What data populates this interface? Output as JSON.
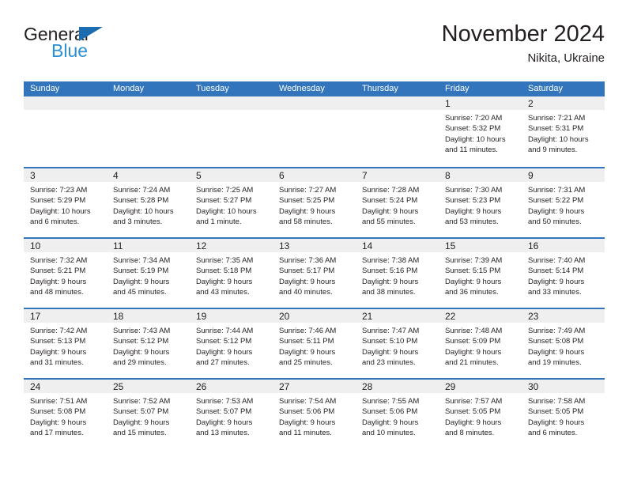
{
  "brand": {
    "line1": "General",
    "line2": "Blue",
    "accent_dark": "#1b6cb0",
    "accent_light": "#2d8fd5"
  },
  "header": {
    "title": "November 2024",
    "subtitle": "Nikita, Ukraine"
  },
  "theme": {
    "header_blue": "#3275bc",
    "day_band_gray": "#efefef",
    "text": "#231f20"
  },
  "weekdays": [
    "Sunday",
    "Monday",
    "Tuesday",
    "Wednesday",
    "Thursday",
    "Friday",
    "Saturday"
  ],
  "weeks": [
    [
      {
        "day": "",
        "empty": true,
        "lines": []
      },
      {
        "day": "",
        "empty": true,
        "lines": []
      },
      {
        "day": "",
        "empty": true,
        "lines": []
      },
      {
        "day": "",
        "empty": true,
        "lines": []
      },
      {
        "day": "",
        "empty": true,
        "lines": []
      },
      {
        "day": "1",
        "empty": false,
        "lines": [
          "Sunrise: 7:20 AM",
          "Sunset: 5:32 PM",
          "Daylight: 10 hours",
          "and 11 minutes."
        ]
      },
      {
        "day": "2",
        "empty": false,
        "lines": [
          "Sunrise: 7:21 AM",
          "Sunset: 5:31 PM",
          "Daylight: 10 hours",
          "and 9 minutes."
        ]
      }
    ],
    [
      {
        "day": "3",
        "empty": false,
        "lines": [
          "Sunrise: 7:23 AM",
          "Sunset: 5:29 PM",
          "Daylight: 10 hours",
          "and 6 minutes."
        ]
      },
      {
        "day": "4",
        "empty": false,
        "lines": [
          "Sunrise: 7:24 AM",
          "Sunset: 5:28 PM",
          "Daylight: 10 hours",
          "and 3 minutes."
        ]
      },
      {
        "day": "5",
        "empty": false,
        "lines": [
          "Sunrise: 7:25 AM",
          "Sunset: 5:27 PM",
          "Daylight: 10 hours",
          "and 1 minute."
        ]
      },
      {
        "day": "6",
        "empty": false,
        "lines": [
          "Sunrise: 7:27 AM",
          "Sunset: 5:25 PM",
          "Daylight: 9 hours",
          "and 58 minutes."
        ]
      },
      {
        "day": "7",
        "empty": false,
        "lines": [
          "Sunrise: 7:28 AM",
          "Sunset: 5:24 PM",
          "Daylight: 9 hours",
          "and 55 minutes."
        ]
      },
      {
        "day": "8",
        "empty": false,
        "lines": [
          "Sunrise: 7:30 AM",
          "Sunset: 5:23 PM",
          "Daylight: 9 hours",
          "and 53 minutes."
        ]
      },
      {
        "day": "9",
        "empty": false,
        "lines": [
          "Sunrise: 7:31 AM",
          "Sunset: 5:22 PM",
          "Daylight: 9 hours",
          "and 50 minutes."
        ]
      }
    ],
    [
      {
        "day": "10",
        "empty": false,
        "lines": [
          "Sunrise: 7:32 AM",
          "Sunset: 5:21 PM",
          "Daylight: 9 hours",
          "and 48 minutes."
        ]
      },
      {
        "day": "11",
        "empty": false,
        "lines": [
          "Sunrise: 7:34 AM",
          "Sunset: 5:19 PM",
          "Daylight: 9 hours",
          "and 45 minutes."
        ]
      },
      {
        "day": "12",
        "empty": false,
        "lines": [
          "Sunrise: 7:35 AM",
          "Sunset: 5:18 PM",
          "Daylight: 9 hours",
          "and 43 minutes."
        ]
      },
      {
        "day": "13",
        "empty": false,
        "lines": [
          "Sunrise: 7:36 AM",
          "Sunset: 5:17 PM",
          "Daylight: 9 hours",
          "and 40 minutes."
        ]
      },
      {
        "day": "14",
        "empty": false,
        "lines": [
          "Sunrise: 7:38 AM",
          "Sunset: 5:16 PM",
          "Daylight: 9 hours",
          "and 38 minutes."
        ]
      },
      {
        "day": "15",
        "empty": false,
        "lines": [
          "Sunrise: 7:39 AM",
          "Sunset: 5:15 PM",
          "Daylight: 9 hours",
          "and 36 minutes."
        ]
      },
      {
        "day": "16",
        "empty": false,
        "lines": [
          "Sunrise: 7:40 AM",
          "Sunset: 5:14 PM",
          "Daylight: 9 hours",
          "and 33 minutes."
        ]
      }
    ],
    [
      {
        "day": "17",
        "empty": false,
        "lines": [
          "Sunrise: 7:42 AM",
          "Sunset: 5:13 PM",
          "Daylight: 9 hours",
          "and 31 minutes."
        ]
      },
      {
        "day": "18",
        "empty": false,
        "lines": [
          "Sunrise: 7:43 AM",
          "Sunset: 5:12 PM",
          "Daylight: 9 hours",
          "and 29 minutes."
        ]
      },
      {
        "day": "19",
        "empty": false,
        "lines": [
          "Sunrise: 7:44 AM",
          "Sunset: 5:12 PM",
          "Daylight: 9 hours",
          "and 27 minutes."
        ]
      },
      {
        "day": "20",
        "empty": false,
        "lines": [
          "Sunrise: 7:46 AM",
          "Sunset: 5:11 PM",
          "Daylight: 9 hours",
          "and 25 minutes."
        ]
      },
      {
        "day": "21",
        "empty": false,
        "lines": [
          "Sunrise: 7:47 AM",
          "Sunset: 5:10 PM",
          "Daylight: 9 hours",
          "and 23 minutes."
        ]
      },
      {
        "day": "22",
        "empty": false,
        "lines": [
          "Sunrise: 7:48 AM",
          "Sunset: 5:09 PM",
          "Daylight: 9 hours",
          "and 21 minutes."
        ]
      },
      {
        "day": "23",
        "empty": false,
        "lines": [
          "Sunrise: 7:49 AM",
          "Sunset: 5:08 PM",
          "Daylight: 9 hours",
          "and 19 minutes."
        ]
      }
    ],
    [
      {
        "day": "24",
        "empty": false,
        "lines": [
          "Sunrise: 7:51 AM",
          "Sunset: 5:08 PM",
          "Daylight: 9 hours",
          "and 17 minutes."
        ]
      },
      {
        "day": "25",
        "empty": false,
        "lines": [
          "Sunrise: 7:52 AM",
          "Sunset: 5:07 PM",
          "Daylight: 9 hours",
          "and 15 minutes."
        ]
      },
      {
        "day": "26",
        "empty": false,
        "lines": [
          "Sunrise: 7:53 AM",
          "Sunset: 5:07 PM",
          "Daylight: 9 hours",
          "and 13 minutes."
        ]
      },
      {
        "day": "27",
        "empty": false,
        "lines": [
          "Sunrise: 7:54 AM",
          "Sunset: 5:06 PM",
          "Daylight: 9 hours",
          "and 11 minutes."
        ]
      },
      {
        "day": "28",
        "empty": false,
        "lines": [
          "Sunrise: 7:55 AM",
          "Sunset: 5:06 PM",
          "Daylight: 9 hours",
          "and 10 minutes."
        ]
      },
      {
        "day": "29",
        "empty": false,
        "lines": [
          "Sunrise: 7:57 AM",
          "Sunset: 5:05 PM",
          "Daylight: 9 hours",
          "and 8 minutes."
        ]
      },
      {
        "day": "30",
        "empty": false,
        "lines": [
          "Sunrise: 7:58 AM",
          "Sunset: 5:05 PM",
          "Daylight: 9 hours",
          "and 6 minutes."
        ]
      }
    ]
  ]
}
